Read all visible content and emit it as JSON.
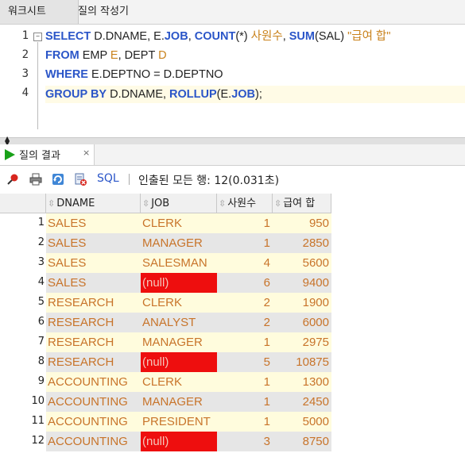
{
  "tabs": [
    "워크시트",
    "질의 작성기"
  ],
  "editor": {
    "line_numbers": [
      "1",
      "2",
      "3",
      "4"
    ],
    "lines": [
      [
        {
          "t": "SELECT",
          "c": "kw"
        },
        {
          "t": " D.DNAME, E.",
          "c": ""
        },
        {
          "t": "JOB",
          "c": "kwp"
        },
        {
          "t": ", ",
          "c": ""
        },
        {
          "t": "COUNT",
          "c": "kw"
        },
        {
          "t": "(*) ",
          "c": ""
        },
        {
          "t": "사원수",
          "c": "alias"
        },
        {
          "t": ", ",
          "c": ""
        },
        {
          "t": "SUM",
          "c": "kw"
        },
        {
          "t": "(SAL) ",
          "c": ""
        },
        {
          "t": "\"급여 합\"",
          "c": "str"
        }
      ],
      [
        {
          "t": "FROM",
          "c": "kw"
        },
        {
          "t": " EMP ",
          "c": ""
        },
        {
          "t": "E",
          "c": "alias"
        },
        {
          "t": ", DEPT ",
          "c": ""
        },
        {
          "t": "D",
          "c": "alias"
        }
      ],
      [
        {
          "t": "WHERE",
          "c": "kw"
        },
        {
          "t": " E.DEPTNO = D.DEPTNO",
          "c": ""
        }
      ],
      [
        {
          "t": "GROUP BY",
          "c": "kw"
        },
        {
          "t": " D.DNAME, ",
          "c": ""
        },
        {
          "t": "ROLLUP",
          "c": "kw"
        },
        {
          "t": "(E.",
          "c": ""
        },
        {
          "t": "JOB",
          "c": "kwp"
        },
        {
          "t": ");",
          "c": ""
        }
      ]
    ]
  },
  "results_tab": {
    "label": "질의 결과",
    "close": "×"
  },
  "toolbar": {
    "sql_label": "SQL",
    "status": "인출된 모든 행: 12(0.031초)"
  },
  "grid": {
    "columns": [
      "DNAME",
      "JOB",
      "사원수",
      "급여 합"
    ],
    "sort_glyph": "⇳",
    "null_color": "#ee0e0e",
    "rows": [
      {
        "n": "1",
        "dname": "SALES",
        "job": "CLERK",
        "emp": "1",
        "sal": "950"
      },
      {
        "n": "2",
        "dname": "SALES",
        "job": "MANAGER",
        "emp": "1",
        "sal": "2850"
      },
      {
        "n": "3",
        "dname": "SALES",
        "job": "SALESMAN",
        "emp": "4",
        "sal": "5600"
      },
      {
        "n": "4",
        "dname": "SALES",
        "job": "(null)",
        "emp": "6",
        "sal": "9400"
      },
      {
        "n": "5",
        "dname": "RESEARCH",
        "job": "CLERK",
        "emp": "2",
        "sal": "1900"
      },
      {
        "n": "6",
        "dname": "RESEARCH",
        "job": "ANALYST",
        "emp": "2",
        "sal": "6000"
      },
      {
        "n": "7",
        "dname": "RESEARCH",
        "job": "MANAGER",
        "emp": "1",
        "sal": "2975"
      },
      {
        "n": "8",
        "dname": "RESEARCH",
        "job": "(null)",
        "emp": "5",
        "sal": "10875"
      },
      {
        "n": "9",
        "dname": "ACCOUNTING",
        "job": "CLERK",
        "emp": "1",
        "sal": "1300"
      },
      {
        "n": "10",
        "dname": "ACCOUNTING",
        "job": "MANAGER",
        "emp": "1",
        "sal": "2450"
      },
      {
        "n": "11",
        "dname": "ACCOUNTING",
        "job": "PRESIDENT",
        "emp": "1",
        "sal": "5000"
      },
      {
        "n": "12",
        "dname": "ACCOUNTING",
        "job": "(null)",
        "emp": "3",
        "sal": "8750"
      }
    ]
  }
}
